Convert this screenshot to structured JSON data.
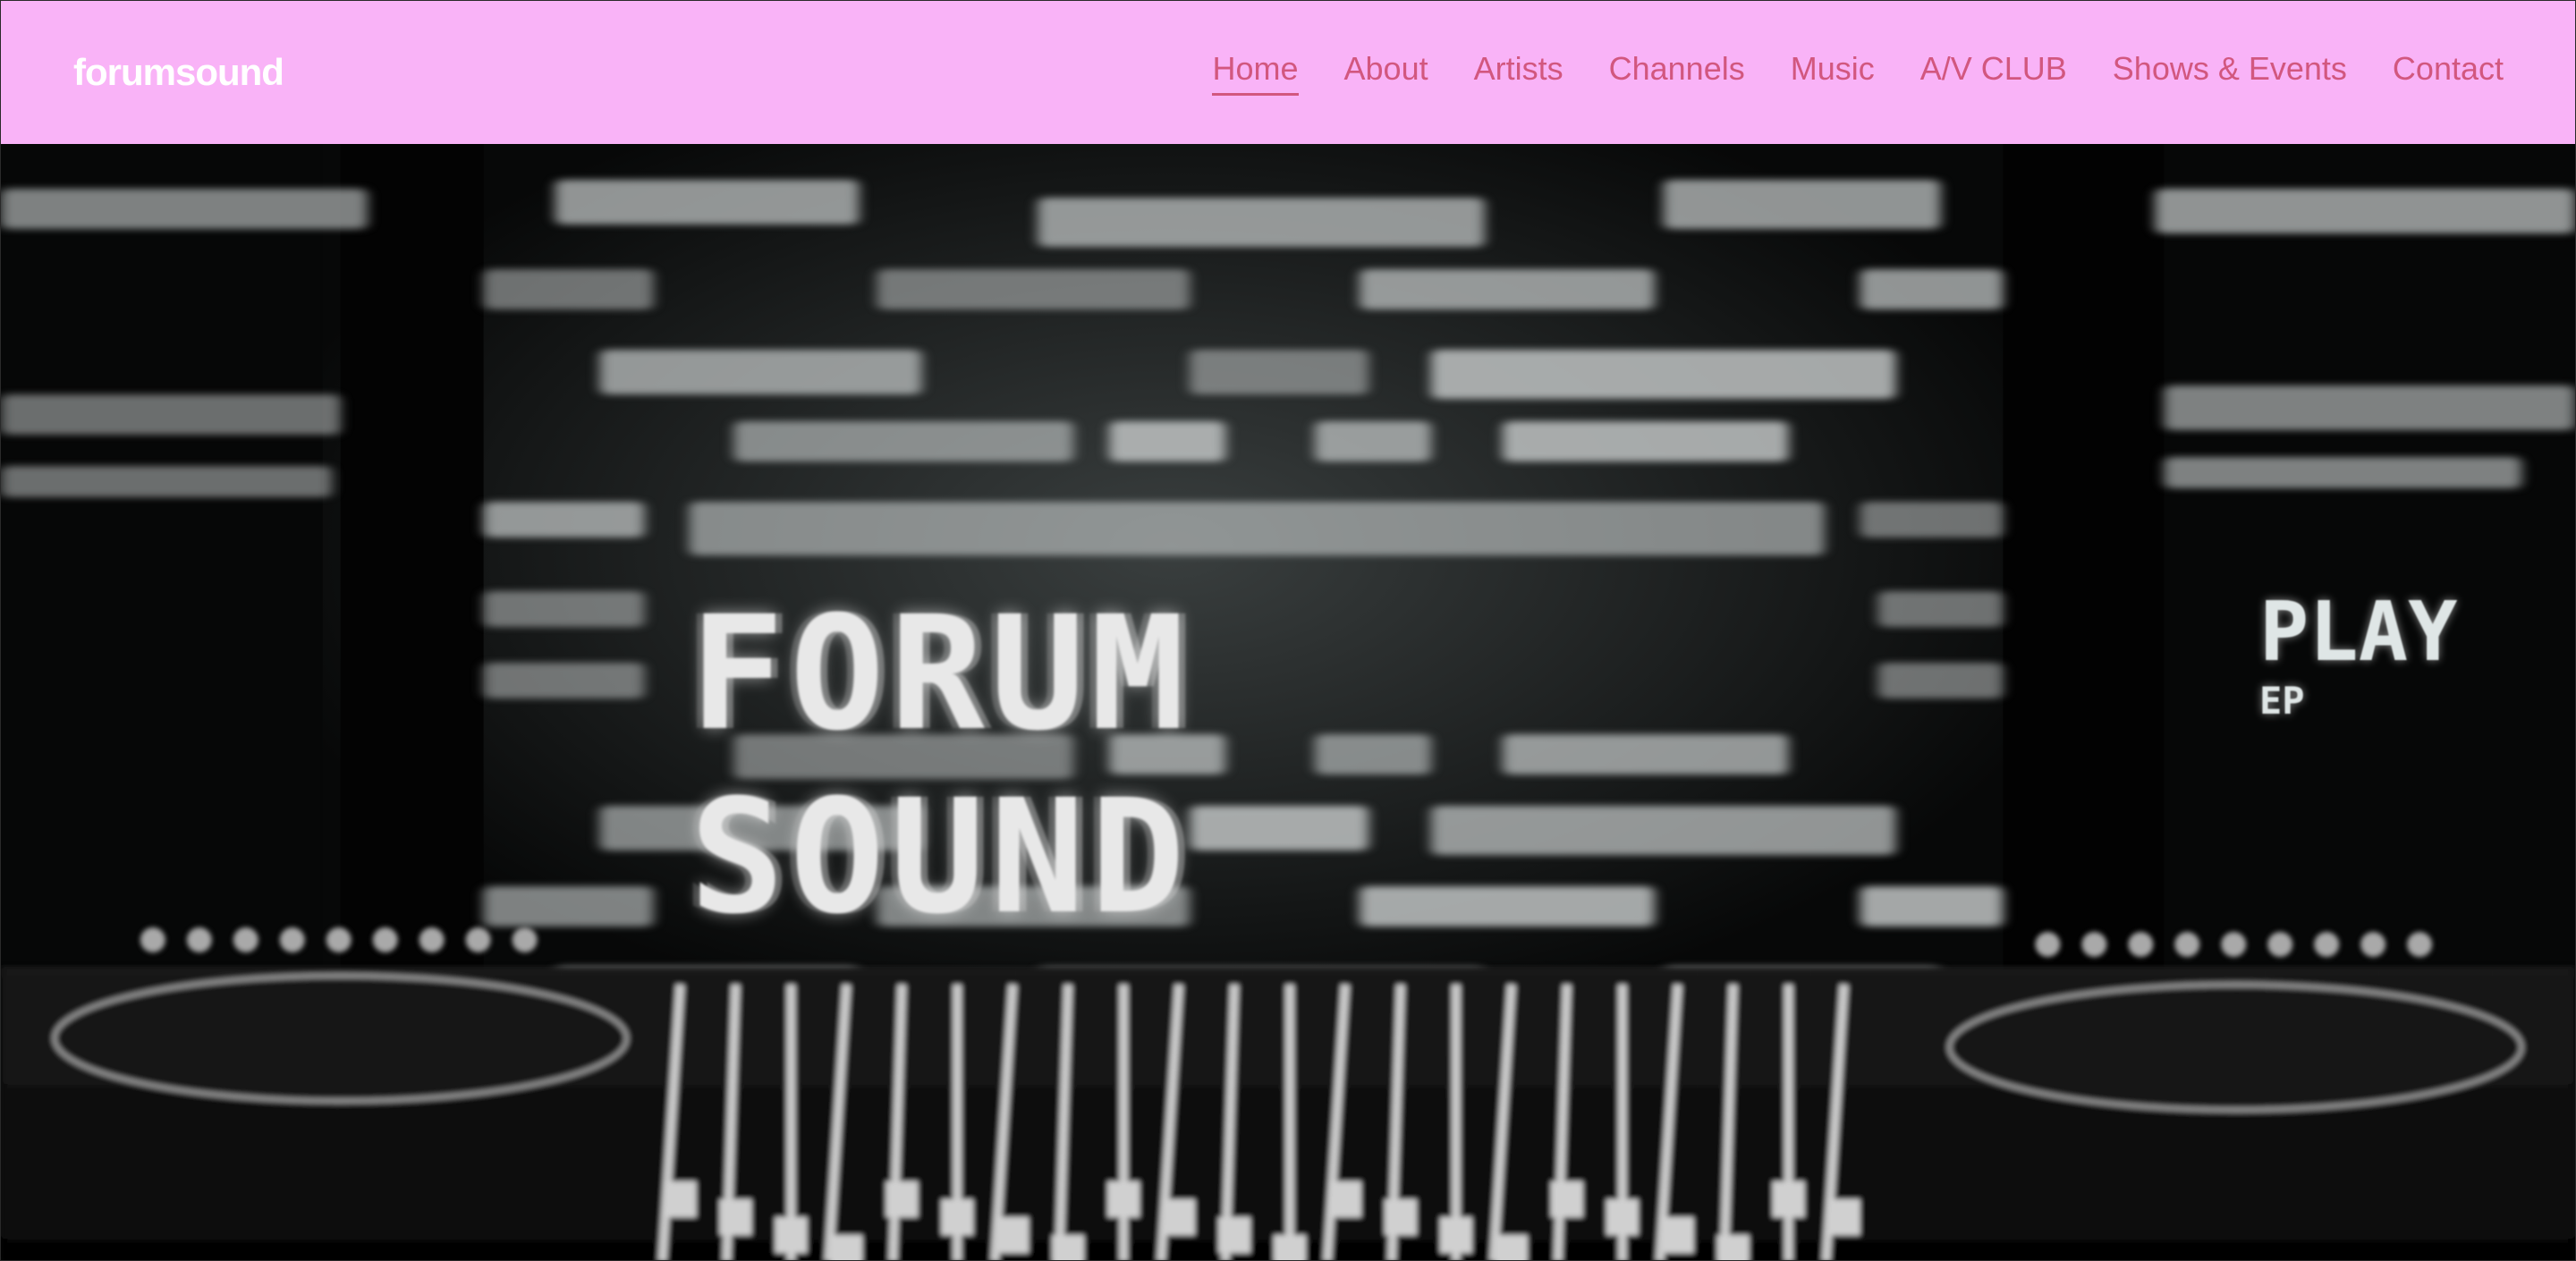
{
  "brand": "forumsound",
  "nav": [
    {
      "label": "Home",
      "active": true
    },
    {
      "label": "About"
    },
    {
      "label": "Artists"
    },
    {
      "label": "Channels"
    },
    {
      "label": "Music"
    },
    {
      "label": "A/V CLUB"
    },
    {
      "label": "Shows & Events"
    },
    {
      "label": "Contact"
    }
  ],
  "hero": {
    "title": "FORUM SOUND",
    "badge": "PLAY",
    "badge_sub": "EP"
  },
  "colors": {
    "header_bg": "#f9b3f7",
    "nav_text": "#d2577f",
    "brand_text": "#ffffff"
  }
}
